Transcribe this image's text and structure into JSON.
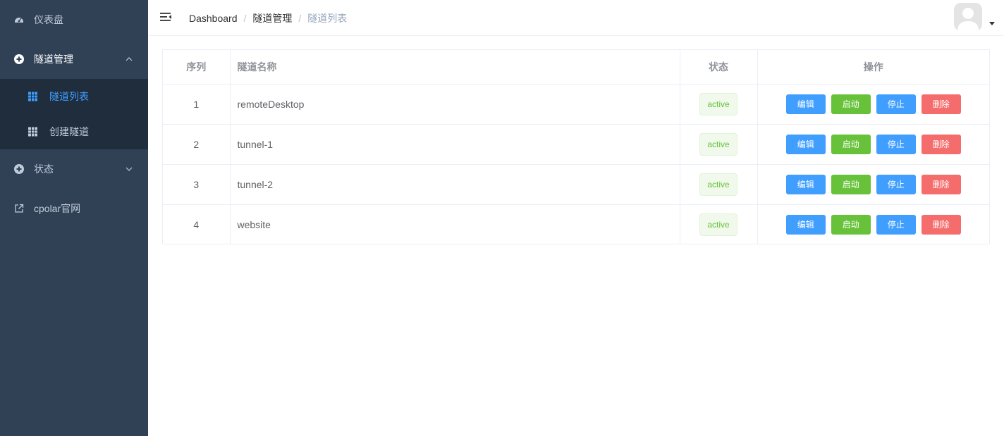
{
  "sidebar": {
    "items": [
      {
        "label": "仪表盘",
        "icon": "dashboard-icon"
      },
      {
        "label": "隧道管理",
        "icon": "plus-circle-icon",
        "expanded": true,
        "children": [
          {
            "label": "隧道列表",
            "icon": "grid-icon",
            "active": true
          },
          {
            "label": "创建隧道",
            "icon": "grid-icon"
          }
        ]
      },
      {
        "label": "状态",
        "icon": "plus-circle-icon",
        "expanded": false
      },
      {
        "label": "cpolar官网",
        "icon": "external-link-icon"
      }
    ]
  },
  "navbar": {
    "breadcrumb": [
      "Dashboard",
      "隧道管理",
      "隧道列表"
    ],
    "separator": "/"
  },
  "table": {
    "headers": [
      "序列",
      "隧道名称",
      "状态",
      "操作"
    ],
    "rows": [
      {
        "index": "1",
        "name": "remoteDesktop",
        "status": "active"
      },
      {
        "index": "2",
        "name": "tunnel-1",
        "status": "active"
      },
      {
        "index": "3",
        "name": "tunnel-2",
        "status": "active"
      },
      {
        "index": "4",
        "name": "website",
        "status": "active"
      }
    ],
    "actions": [
      "编辑",
      "启动",
      "停止",
      "删除"
    ]
  },
  "colors": {
    "sidebar_bg": "#304156",
    "submenu_bg": "#1f2d3d",
    "active": "#409eff",
    "edit": "#409eff",
    "start": "#67c23a",
    "stop": "#409eff",
    "delete": "#f56c6c",
    "tag_text": "#67c23a"
  }
}
